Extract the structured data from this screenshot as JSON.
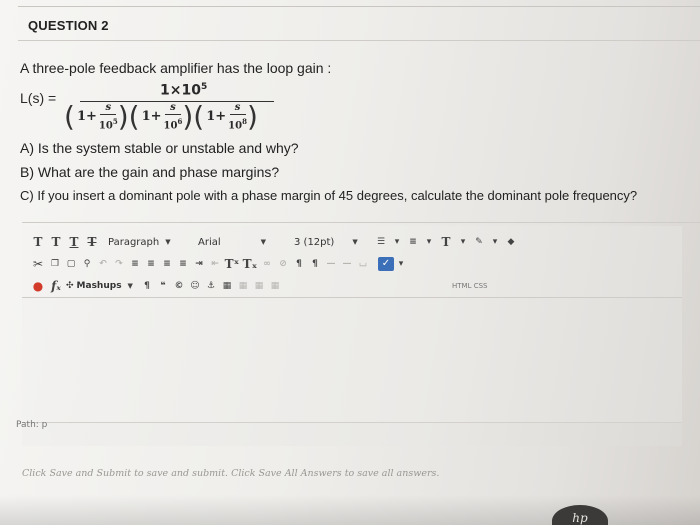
{
  "question": {
    "title": "QUESTION 2",
    "stem": "A three-pole feedback amplifier has the loop gain :",
    "formula": {
      "lhs": "L(s) =",
      "numerator_coef": "1×10",
      "numerator_exp": "5",
      "terms": [
        {
          "one_plus": "1+",
          "num": "s",
          "den_base": "10",
          "den_exp": "5"
        },
        {
          "one_plus": "1+",
          "num": "s",
          "den_base": "10",
          "den_exp": "6"
        },
        {
          "one_plus": "1+",
          "num": "s",
          "den_base": "10",
          "den_exp": "8"
        }
      ]
    },
    "parts": {
      "a": "A) Is the system stable or unstable and why?",
      "b": "B) What are the gain and phase margins?",
      "c": "C)  If you insert a dominant pole with a phase margin of 45 degrees, calculate the dominant pole frequency?"
    }
  },
  "toolbar": {
    "row1": {
      "format_buttons": [
        "T",
        "T",
        "T",
        "T"
      ],
      "paragraph_select": "Paragraph",
      "font_select": "Arial",
      "size_select": "3 (12pt)",
      "text_color_label": "T"
    },
    "row2": {
      "superscript_label": "Tˣ",
      "subscript_label": "Tₓ"
    },
    "row3": {
      "mashups_label": "Mashups",
      "fx_label": "fₓ",
      "html_css_label": "HTML CSS"
    }
  },
  "editor": {
    "path_label": "Path: p"
  },
  "footer": {
    "hint": "Click Save and Submit to save and submit. Click Save All Answers to save all answers."
  },
  "colors": {
    "accent_blue": "#3b6fb8",
    "icon_red": "#d23a2a",
    "background": "#efeeeb"
  }
}
